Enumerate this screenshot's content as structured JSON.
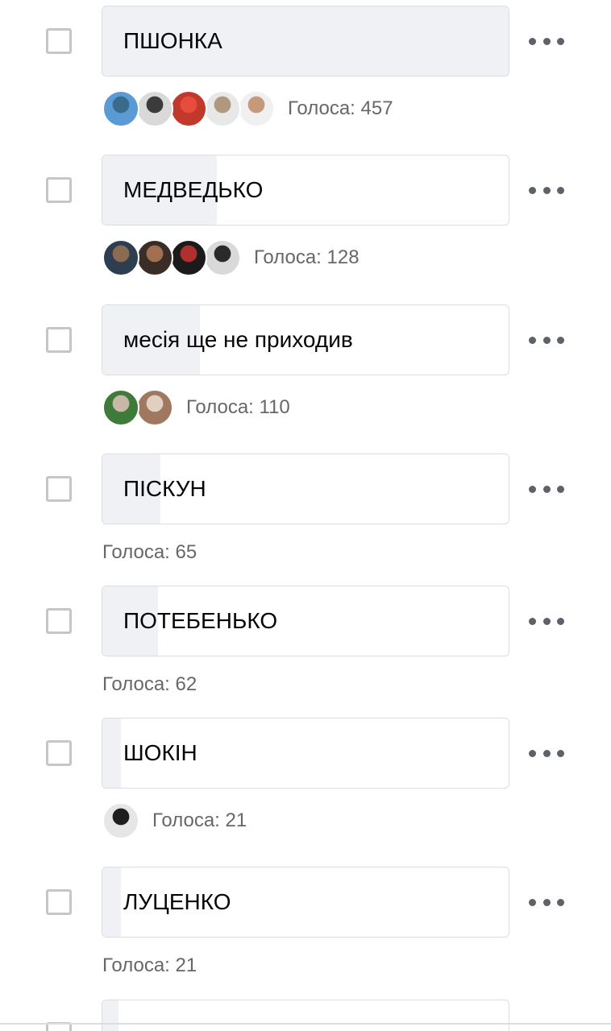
{
  "poll": {
    "options": [
      {
        "label": "ПШОНКА",
        "votes_text": "Голоса: 457",
        "votes": 457,
        "fill_fraction": 1.0,
        "avatars": [
          {
            "name": "avatar-1",
            "color_a": "#5b9bd5",
            "color_b": "#3a6b8c"
          },
          {
            "name": "avatar-2",
            "color_a": "#d9d9d9",
            "color_b": "#3b3b3b"
          },
          {
            "name": "avatar-3",
            "color_a": "#c0392b",
            "color_b": "#e74c3c"
          },
          {
            "name": "avatar-4",
            "color_a": "#e8e8e8",
            "color_b": "#b09880"
          },
          {
            "name": "avatar-5",
            "color_a": "#f0f0f0",
            "color_b": "#c49a7a"
          }
        ]
      },
      {
        "label": "МЕДВЕДЬКО",
        "votes_text": "Голоса: 128",
        "votes": 128,
        "fill_fraction": 0.28,
        "avatars": [
          {
            "name": "avatar-1",
            "color_a": "#2c3e50",
            "color_b": "#8c6b50"
          },
          {
            "name": "avatar-2",
            "color_a": "#3a2d28",
            "color_b": "#a07050"
          },
          {
            "name": "avatar-3",
            "color_a": "#1b1b1b",
            "color_b": "#b03030"
          },
          {
            "name": "avatar-4",
            "color_a": "#d9d9d9",
            "color_b": "#2a2a2a"
          }
        ]
      },
      {
        "label": "месія ще не приходив",
        "votes_text": "Голоса: 110",
        "votes": 110,
        "fill_fraction": 0.24,
        "avatars": [
          {
            "name": "avatar-1",
            "color_a": "#3e7a3a",
            "color_b": "#c8b8a8"
          },
          {
            "name": "avatar-2",
            "color_a": "#a07860",
            "color_b": "#e0d0c0"
          }
        ]
      },
      {
        "label": "ПІСКУН",
        "votes_text": "Голоса: 65",
        "votes": 65,
        "fill_fraction": 0.142,
        "avatars": []
      },
      {
        "label": "ПОТЕБЕНЬКО",
        "votes_text": "Голоса: 62",
        "votes": 62,
        "fill_fraction": 0.136,
        "avatars": []
      },
      {
        "label": "ШОКІН",
        "votes_text": "Голоса: 21",
        "votes": 21,
        "fill_fraction": 0.046,
        "avatars": [
          {
            "name": "avatar-1",
            "color_a": "#e6e6e6",
            "color_b": "#1e1e1e"
          }
        ]
      },
      {
        "label": "ЛУЦЕНКО",
        "votes_text": "Голоса: 21",
        "votes": 21,
        "fill_fraction": 0.046,
        "avatars": []
      }
    ],
    "partial_option_fill_fraction": 0.04
  },
  "colors": {
    "bar_fill": "#eff1f5",
    "bar_border": "#dadde1",
    "checkbox_border": "#c4c6ca",
    "votes_text": "#65676b",
    "label_text": "#050505",
    "more_dots": "#5e6167"
  },
  "icons": {
    "checkbox": "checkbox-unchecked-icon",
    "more": "more-horizontal-icon"
  }
}
